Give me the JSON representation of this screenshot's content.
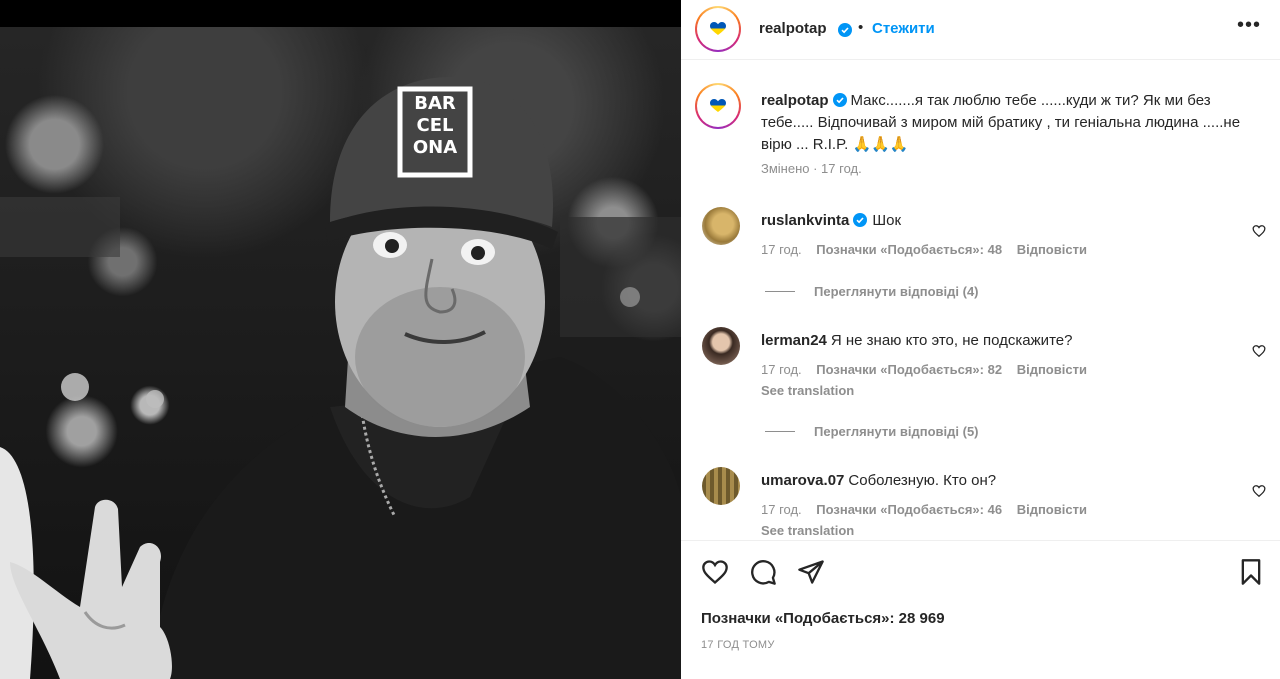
{
  "post": {
    "author": "realpotap",
    "follow_label": "Стежити",
    "separator": "•",
    "more_label": "•••",
    "cap_text": "BARCELONA",
    "caption": {
      "username": "realpotap",
      "text": "Макс.......я так люблю тебе ......куди ж ти? Як ми без тебе..... Відпочивай з миром мій братику , ти геніальна людина .....не вірю ... R.I.P. 🙏🙏🙏",
      "meta": "Змінено · 17 год."
    },
    "comments": [
      {
        "username": "ruslankvinta",
        "verified": true,
        "text": "Шок",
        "time": "17 год.",
        "likes": "Позначки «Подобається»: 48",
        "reply": "Відповісти",
        "translation": "",
        "view_replies": "Переглянути відповіді (4)"
      },
      {
        "username": "lerman24",
        "verified": false,
        "text": "Я не знаю кто это, не подскажите?",
        "time": "17 год.",
        "likes": "Позначки «Подобається»: 82",
        "reply": "Відповісти",
        "translation": "See translation",
        "view_replies": "Переглянути відповіді (5)"
      },
      {
        "username": "umarova.07",
        "verified": false,
        "text": "Соболезную. Кто он?",
        "time": "17 год.",
        "likes": "Позначки «Подобається»: 46",
        "reply": "Відповісти",
        "translation": "See translation",
        "view_replies": ""
      }
    ],
    "likes_total": "Позначки «Подобається»: 28 969",
    "posted_ago": "17 ГОД ТОМУ",
    "icons": {
      "like": "heart-outline-icon",
      "comment": "comment-bubble-icon",
      "share": "paper-plane-icon",
      "save": "bookmark-icon",
      "verified": "verified-badge-icon"
    },
    "colors": {
      "accent": "#0095f6",
      "muted": "#8e8e8e",
      "text": "#262626",
      "flag_blue": "#0057b7",
      "flag_yellow": "#ffd700"
    }
  }
}
